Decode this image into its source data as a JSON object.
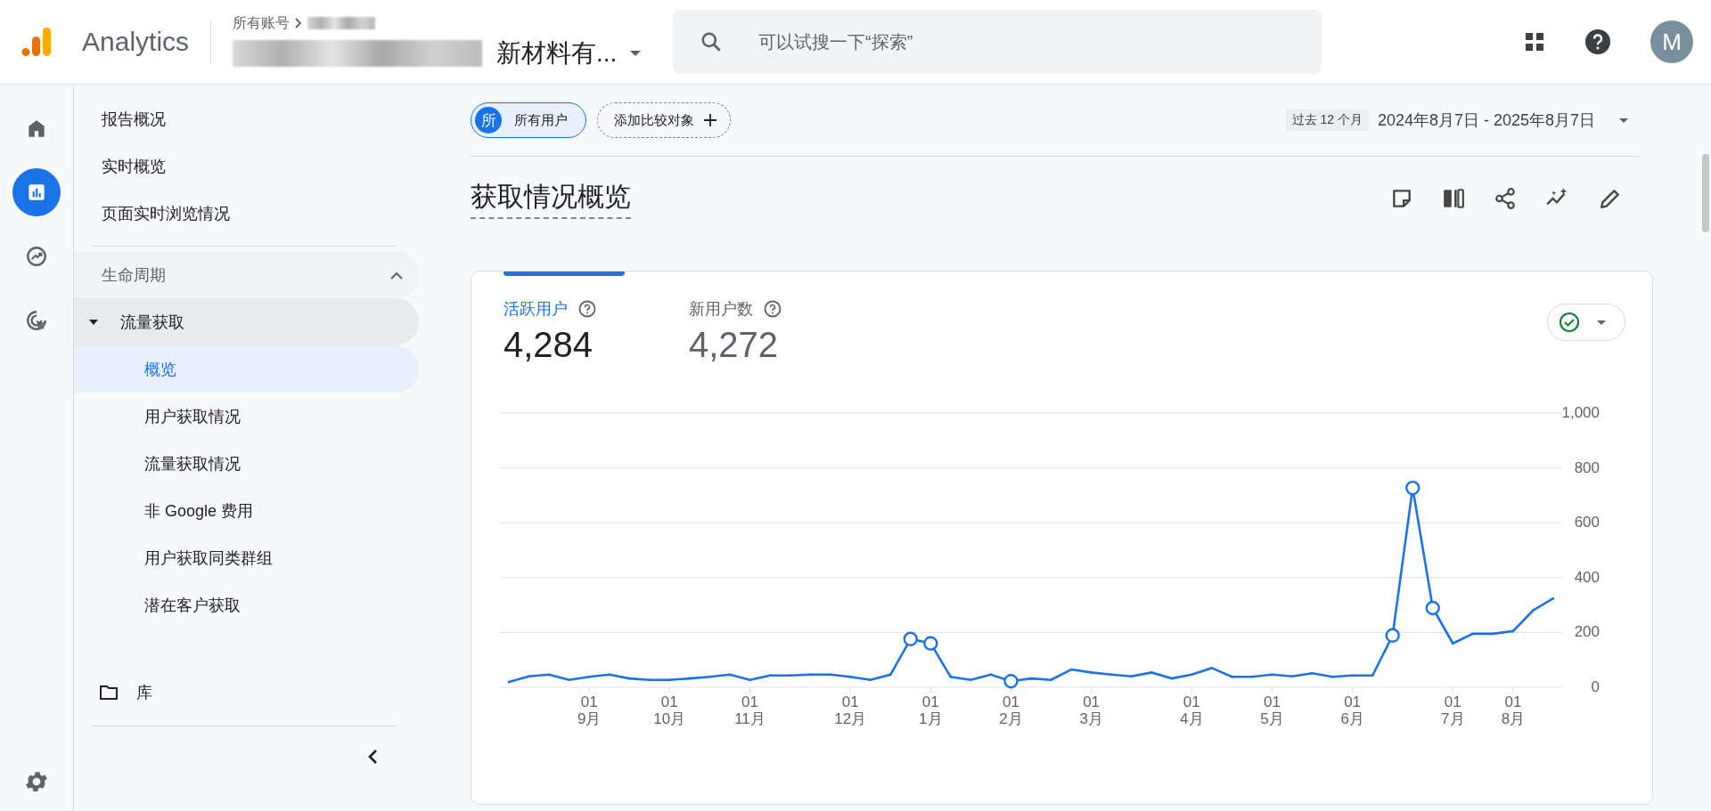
{
  "header": {
    "product": "Analytics",
    "breadcrumb": "所有账号",
    "account": "新材料有...",
    "search": {
      "placeholder": "可以试搜一下“探索”"
    },
    "avatar": "M"
  },
  "rail": [
    {
      "kind": "home",
      "selected": false
    },
    {
      "kind": "reports",
      "selected": true
    },
    {
      "kind": "explore",
      "selected": false
    },
    {
      "kind": "advertising",
      "selected": false
    }
  ],
  "nav": {
    "items": [
      {
        "label": "报告概况"
      },
      {
        "label": "实时概览"
      },
      {
        "label": "页面实时浏览情况"
      }
    ],
    "sections": [
      {
        "label": "生命周期",
        "expanded": true,
        "children": [
          {
            "label": "流量获取",
            "expanded": true,
            "children": [
              {
                "label": "概览",
                "selected": true
              },
              {
                "label": "用户获取情况",
                "selected": false
              },
              {
                "label": "流量获取情况",
                "selected": false
              },
              {
                "label": "非 Google 费用",
                "selected": false
              },
              {
                "label": "用户获取同类群组",
                "selected": false
              },
              {
                "label": "潜在客户获取",
                "selected": false
              }
            ]
          }
        ]
      }
    ],
    "library": "库"
  },
  "toolbar": {
    "segment": {
      "badge": "所",
      "label": "所有用户"
    },
    "compare": "添加比较对象",
    "period": "过去 12 个月",
    "date_range": "2024年8月7日 - 2025年8月7日"
  },
  "title": "获取情况概览",
  "card": {
    "anomaly_points": [
      false,
      false,
      false,
      false,
      false,
      false,
      false,
      false,
      false,
      false,
      false,
      false,
      false,
      false,
      false,
      false,
      false,
      false,
      false,
      false,
      true,
      true,
      false,
      false,
      false,
      true,
      false,
      false,
      false,
      false,
      false,
      false,
      false,
      false,
      false,
      false,
      false,
      false,
      false,
      false,
      false,
      false,
      false,
      false,
      true,
      true,
      true,
      false,
      false,
      false,
      false,
      false,
      false
    ],
    "metrics": [
      {
        "label": "活跃用户",
        "value": "4,284",
        "selected": true
      },
      {
        "label": "新用户数",
        "value": "4,272",
        "selected": false
      }
    ],
    "chart_data": {
      "type": "line",
      "categories": [
        null,
        null,
        null,
        null,
        "01 9月",
        null,
        null,
        null,
        "01 10月",
        null,
        null,
        null,
        "01 11月",
        null,
        null,
        null,
        null,
        "01 12月",
        null,
        null,
        null,
        "01 1月",
        null,
        null,
        null,
        "01 2月",
        null,
        null,
        null,
        "01 3月",
        null,
        null,
        null,
        null,
        "01 4月",
        null,
        null,
        null,
        "01 5月",
        null,
        null,
        null,
        "01 6月",
        null,
        null,
        null,
        null,
        "01 7月",
        null,
        null,
        "01 8月",
        null,
        null
      ],
      "series": [
        {
          "color": "#1a73e8",
          "values": [
            19,
            40,
            46,
            27,
            38,
            46,
            32,
            27,
            27,
            32,
            38,
            46,
            27,
            43,
            43,
            46,
            46,
            38,
            27,
            46,
            176,
            160,
            38,
            27,
            46,
            22,
            32,
            27,
            65,
            54,
            46,
            40,
            54,
            32,
            46,
            70,
            38,
            38,
            46,
            40,
            51,
            38,
            43,
            43,
            189,
            727,
            289,
            160,
            195,
            195,
            205,
            281,
            324
          ]
        }
      ],
      "grid": true,
      "ylim": [
        0,
        1000
      ],
      "yticks": [
        0,
        200,
        400,
        600,
        800,
        {
          "value": 1000,
          "label": "1,000"
        }
      ]
    }
  }
}
